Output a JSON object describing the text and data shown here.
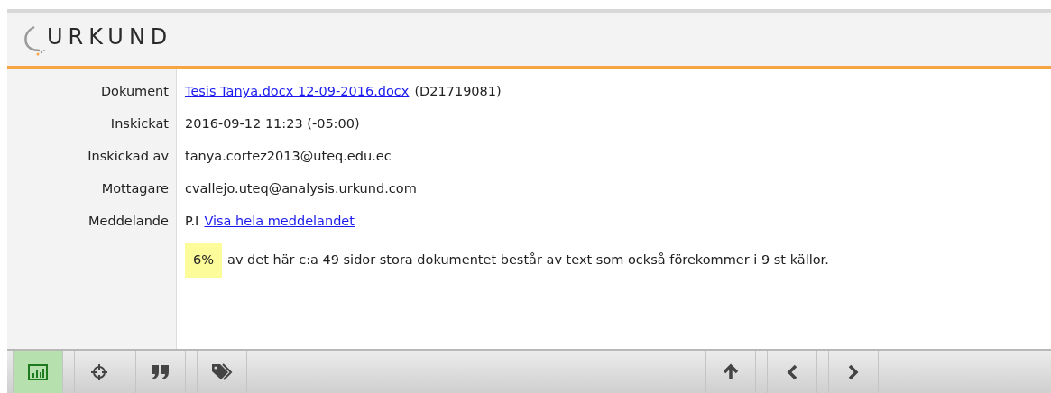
{
  "logo": {
    "text": "URKUND"
  },
  "details": [
    {
      "label": "Dokument",
      "link": "Tesis Tanya.docx 12-09-2016.docx",
      "text": "(D21719081)",
      "kind": "link_first"
    },
    {
      "label": "Inskickat",
      "text": "2016-09-12 11:23 (-05:00)",
      "kind": "plain"
    },
    {
      "label": "Inskickad av",
      "text": "tanya.cortez2013@uteq.edu.ec",
      "kind": "plain"
    },
    {
      "label": "Mottagare",
      "text": "cvallejo.uteq@analysis.urkund.com",
      "kind": "plain"
    },
    {
      "label": "Meddelande",
      "text": "P.I",
      "link": "Visa hela meddelandet",
      "kind": "link_last"
    }
  ],
  "summary": {
    "percentage": "6%",
    "text": "av det här c:a 49 sidor stora dokumentet består av text som också förekommer i 9 st källor."
  },
  "toolbar_left": [
    {
      "kind": "chart",
      "selected": true
    },
    {
      "kind": "crosshair",
      "selected": false
    },
    {
      "kind": "quote",
      "selected": false
    },
    {
      "kind": "tags",
      "selected": false
    }
  ],
  "toolbar_right": [
    {
      "kind": "up",
      "selected": false
    },
    {
      "kind": "prev",
      "selected": false
    },
    {
      "kind": "next",
      "selected": false
    }
  ]
}
